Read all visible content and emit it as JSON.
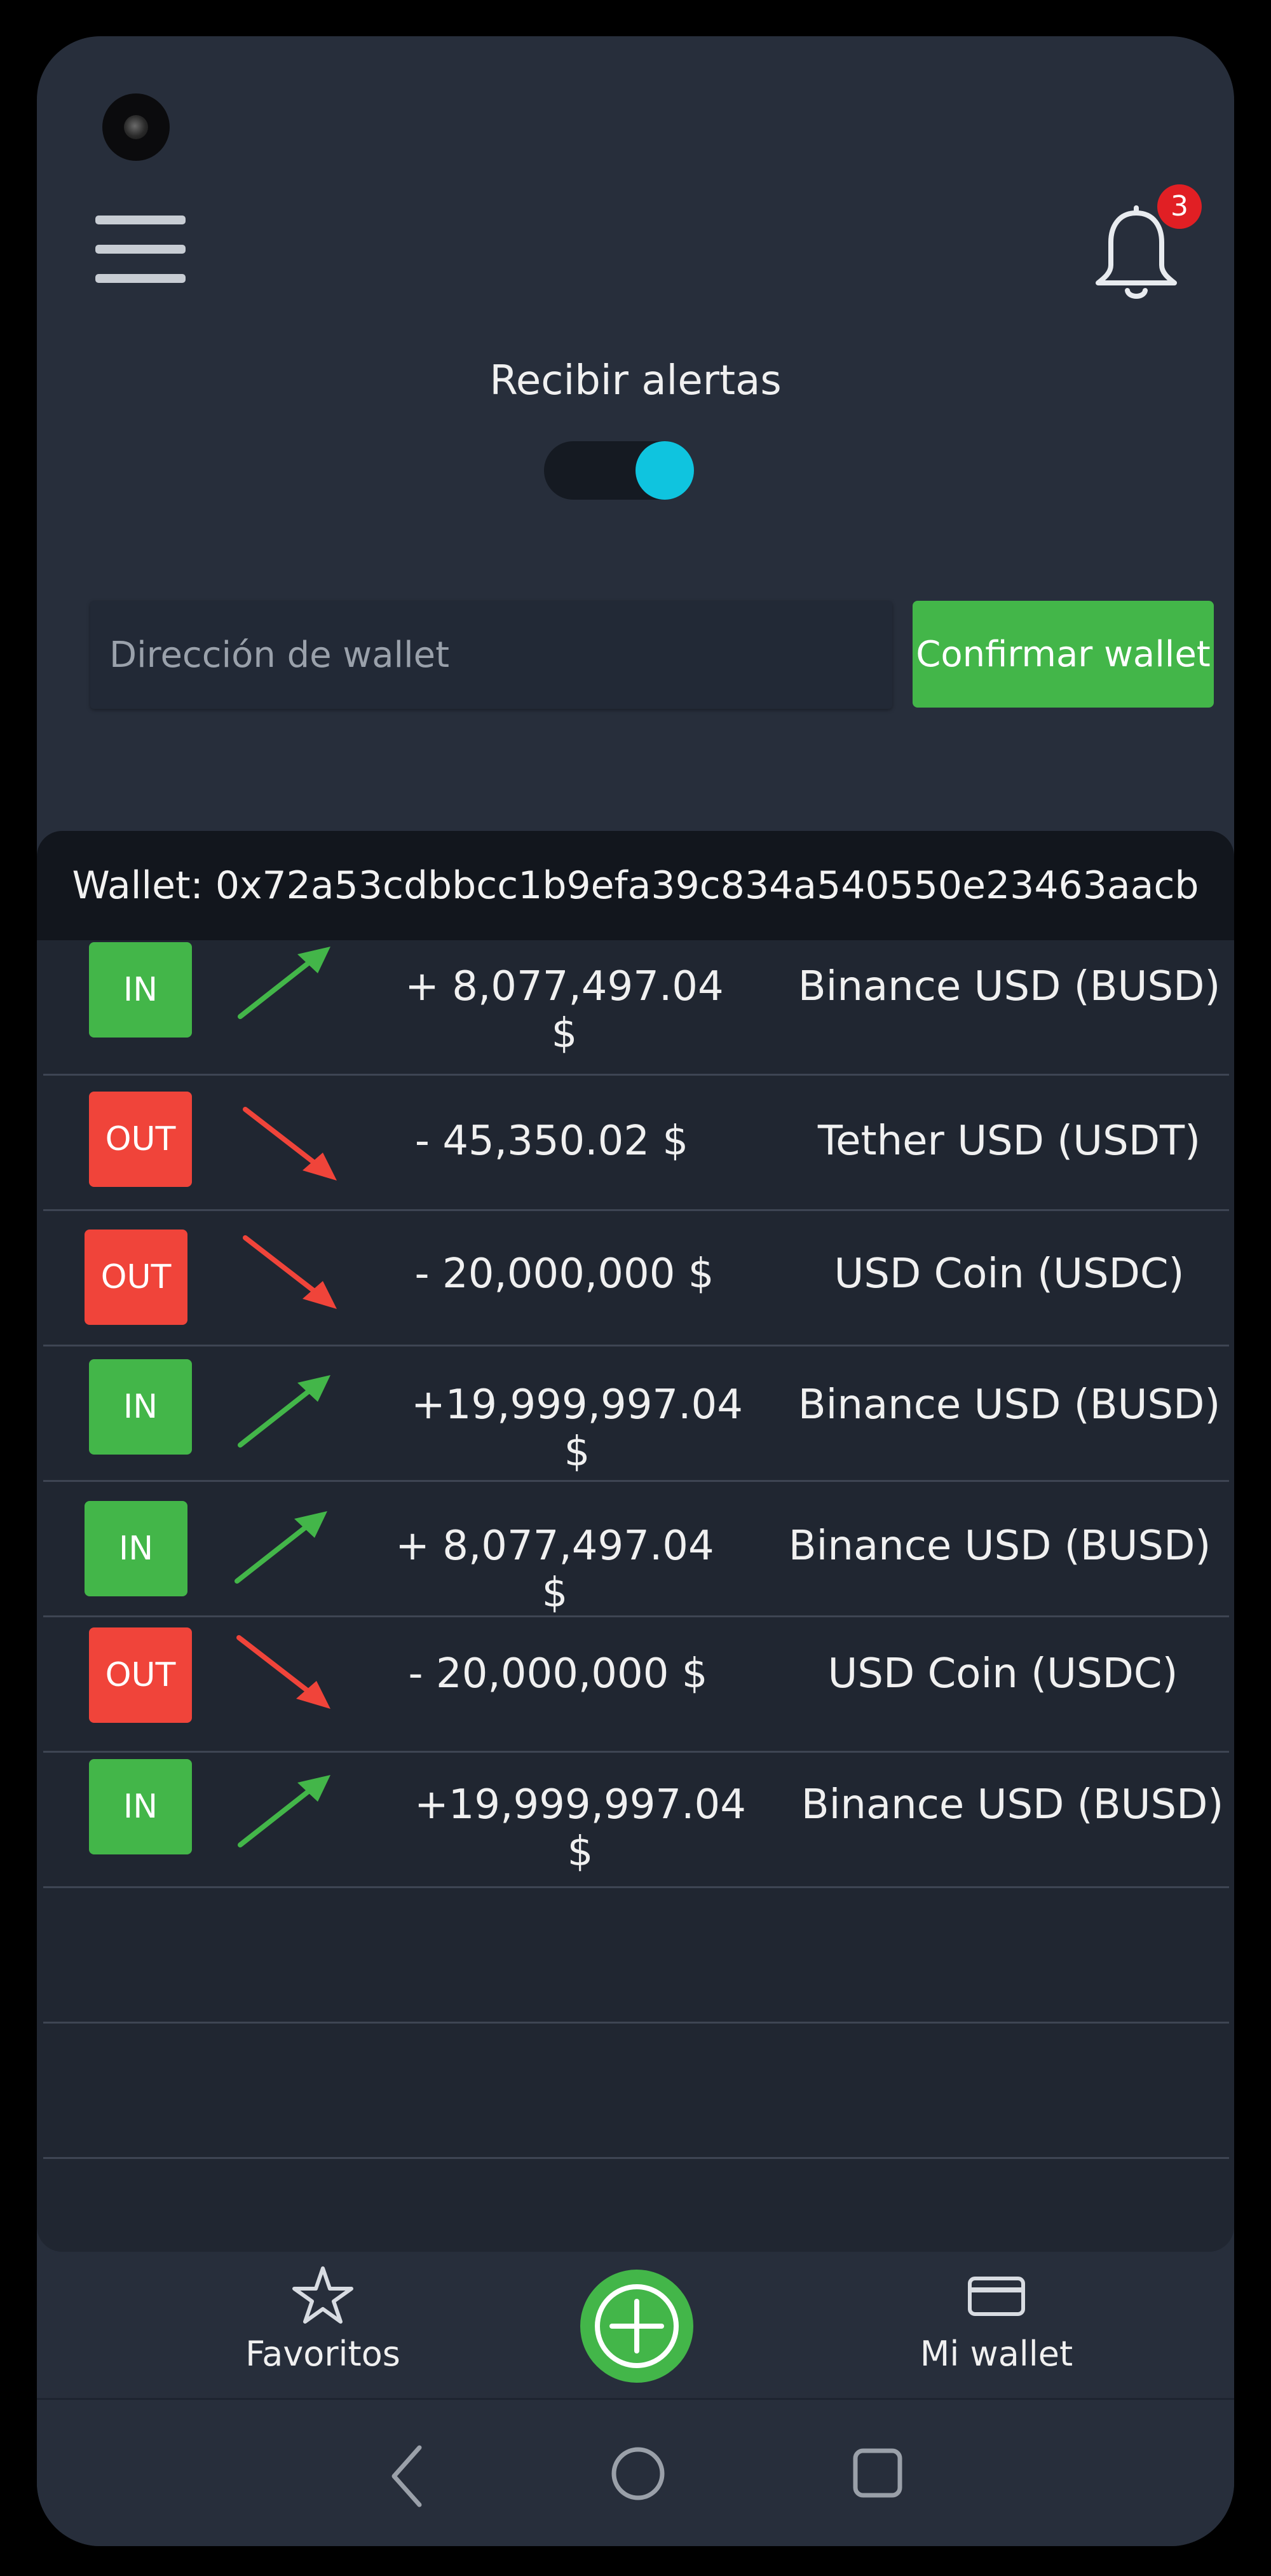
{
  "header": {
    "notification_count": "3"
  },
  "alerts": {
    "label": "Recibir alertas",
    "toggle_on": true
  },
  "wallet_form": {
    "input_value": "",
    "input_placeholder": "Dirección de wallet",
    "confirm_label": "Confirmar wallet"
  },
  "wallet_card": {
    "header": "Wallet: 0x72a53cdbbcc1b9efa39c834a540550e23463aacb",
    "rows": [
      {
        "direction": "IN",
        "amount": "+ 8,077,497.04 $",
        "token": "Binance USD (BUSD)"
      },
      {
        "direction": "OUT",
        "amount": "- 45,350.02 $",
        "token": "Tether USD (USDT)"
      },
      {
        "direction": "OUT",
        "amount": "- 20,000,000 $",
        "token": "USD Coin (USDC)"
      },
      {
        "direction": "IN",
        "amount": "+19,999,997.04 $",
        "token": "Binance USD (BUSD)"
      },
      {
        "direction": "IN",
        "amount": "+ 8,077,497.04 $",
        "token": "Binance USD (BUSD)"
      },
      {
        "direction": "OUT",
        "amount": "- 20,000,000 $",
        "token": "USD Coin (USDC)"
      },
      {
        "direction": "IN",
        "amount": "+19,999,997.04 $",
        "token": "Binance USD (BUSD)"
      }
    ]
  },
  "bottom_nav": {
    "favorites_label": "Favoritos",
    "wallet_label": "Mi wallet"
  },
  "icons": {
    "menu": "menu-icon",
    "bell": "bell-icon",
    "favorites": "star-icon",
    "add": "plus-circle-icon",
    "wallet": "card-icon",
    "back": "back-icon",
    "home": "home-icon",
    "recents": "recents-icon",
    "in_arrow": "arrow-up-right-icon",
    "out_arrow": "arrow-down-right-icon"
  },
  "colors": {
    "background": "#272e3b",
    "card": "#202631",
    "card_header": "#12161d",
    "in": "#43b649",
    "out": "#f0443a",
    "toggle_knob": "#0fc4df",
    "badge": "#e11f24"
  }
}
